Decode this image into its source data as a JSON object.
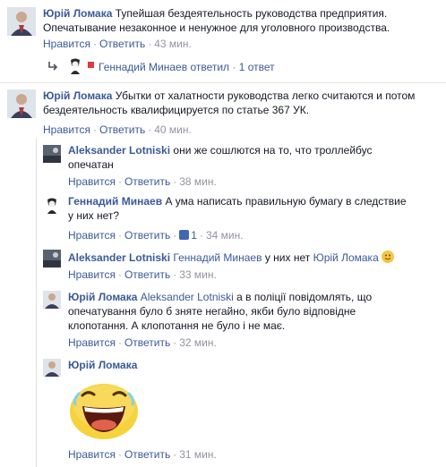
{
  "comments": [
    {
      "author": "Юрій Ломака",
      "line1": "Тупейшая бездеятельность руководства предприятия.",
      "line2": "Опечатывание незаконное и ненужное для уголовного производства.",
      "like": "Нравится",
      "reply": "Ответить",
      "time": "43 мин."
    },
    {
      "author": "Юрій Ломака",
      "line1": "Убытки от халатности руководства легко считаются и потом",
      "line2": "бездеятельность квалифицируется по статье 367 УК.",
      "like": "Нравится",
      "reply": "Ответить",
      "time": "40 мин."
    }
  ],
  "reply_summary": {
    "author": "Геннадий Минаев",
    "action": "ответил",
    "count": "1 ответ"
  },
  "replies": [
    {
      "author": "Aleksander Lotniski",
      "line1": "они же сошлются на то, что троллейбус",
      "line2": "опечатан",
      "like": "Нравится",
      "reply": "Ответить",
      "time": "38 мин."
    },
    {
      "author": "Геннадий Минаев",
      "line1": "А ума написать правильную бумагу в следствие",
      "line2": "у них нет?",
      "like": "Нравится",
      "reply": "Ответить",
      "likes": "1",
      "time": "34 мин."
    },
    {
      "author": "Aleksander Lotniski",
      "mention": "Геннадий Минаев",
      "text_mid": "у них нет",
      "mention2": "Юрій Ломака",
      "like": "Нравится",
      "reply": "Ответить",
      "time": "33 мин."
    },
    {
      "author": "Юрій Ломака",
      "mention": "Aleksander Lotniski",
      "line1": "а в поліції повідомлять, що",
      "line2": "опечатування було б зняте негайно, якби було відповідне",
      "line3": "клопотання. А клопотання не було і не має.",
      "like": "Нравится",
      "reply": "Ответить",
      "time": "32 мин."
    },
    {
      "author": "Юрій Ломака",
      "like": "Нравится",
      "reply": "Ответить",
      "time": "31 мин."
    }
  ]
}
